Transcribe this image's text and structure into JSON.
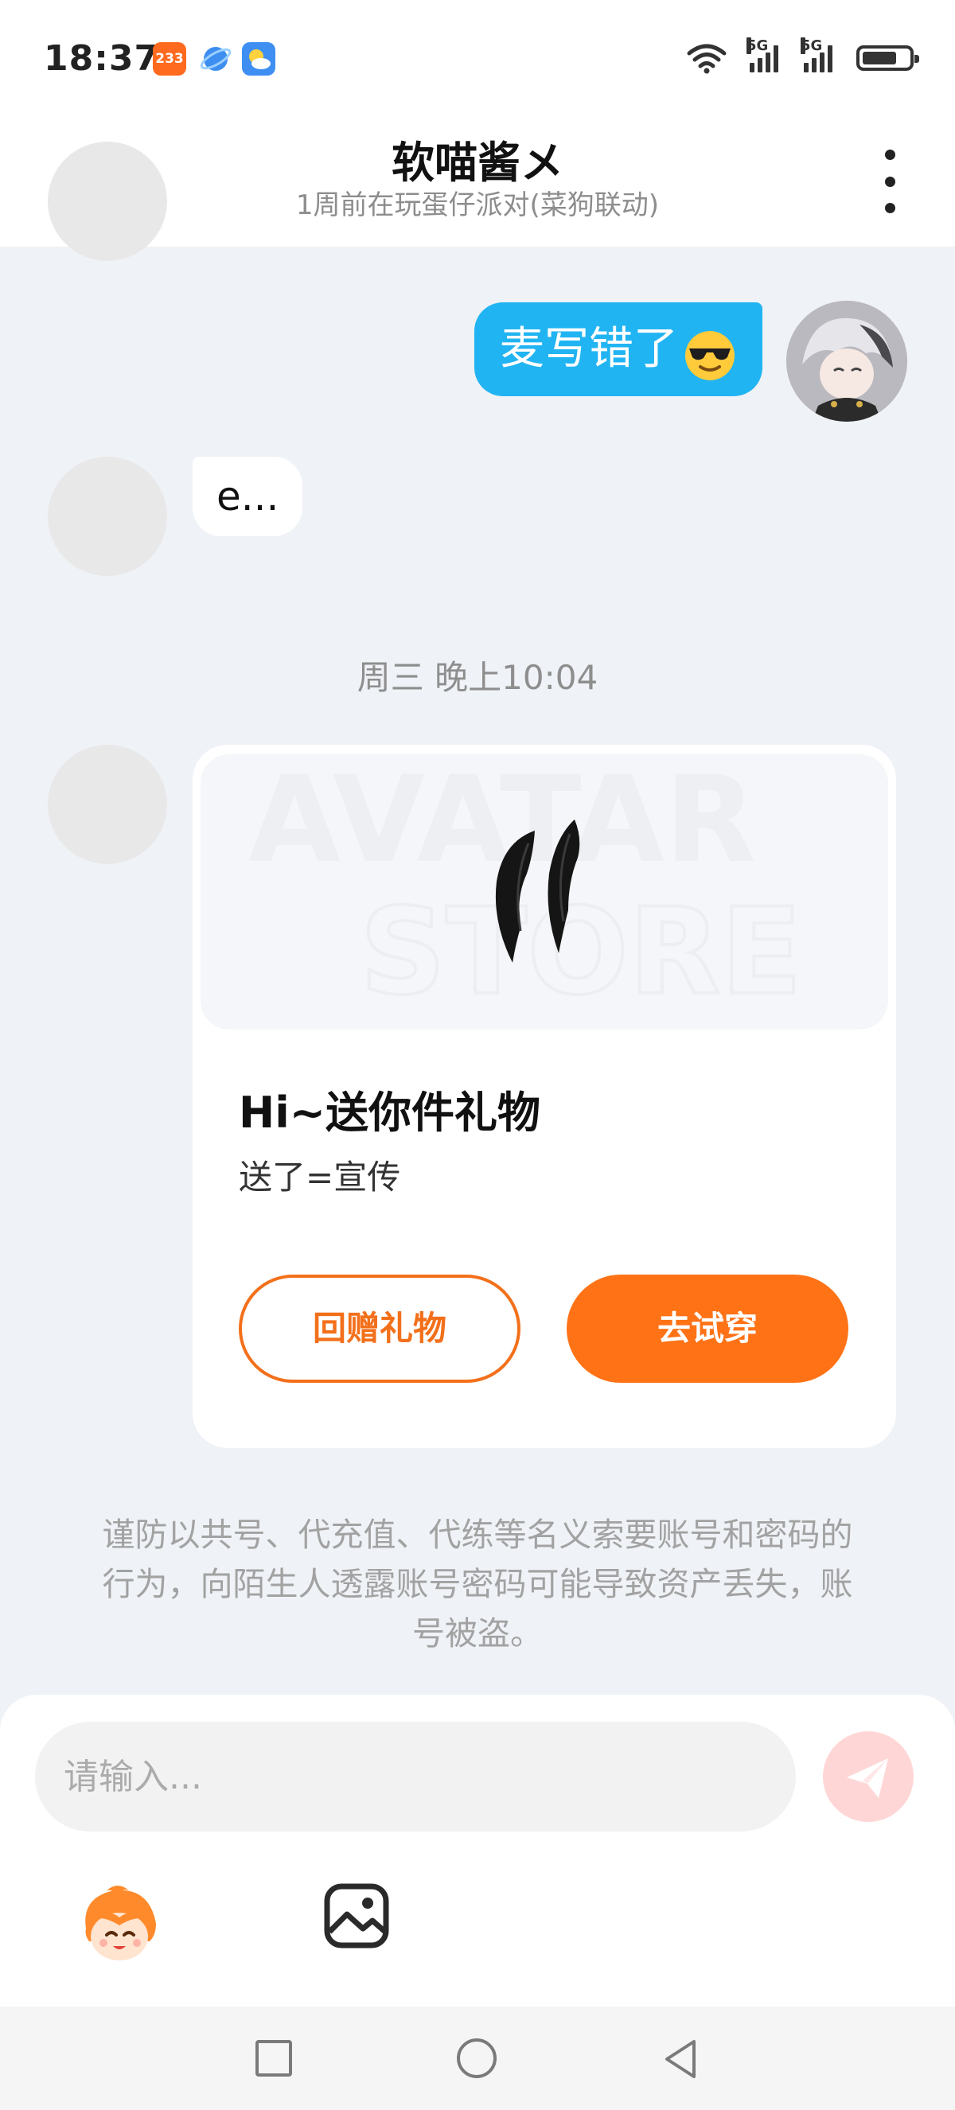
{
  "status_bar": {
    "time": "18:37",
    "app_badge": "233",
    "network_1": "5G",
    "network_2": "5G",
    "battery_level": 0.75
  },
  "header": {
    "title": "软喵酱メ",
    "subtitle": "1周前在玩蛋仔派对(菜狗联动)",
    "back_icon": "chevron-left-icon",
    "more_icon": "more-vertical-icon"
  },
  "messages": {
    "outgoing_text": "麦写错了",
    "outgoing_emoji": "sunglasses-face-emoji",
    "incoming_text": "e...",
    "timestamp": "周三 晚上10:04"
  },
  "gift_card": {
    "watermark_line1": "AVATAR",
    "watermark_line2": "STORE",
    "title": "Hi~送你件礼物",
    "message": "送了=宣传",
    "return_gift_label": "回赠礼物",
    "try_on_label": "去试穿"
  },
  "notice": "谨防以共号、代充值、代练等名义索要账号和密码的行为，向陌生人透露账号密码可能导致资产丢失，账号被盗。",
  "input": {
    "placeholder": "请输入...",
    "value": ""
  },
  "toolbar": {
    "emoji_icon": "character-emoji-icon",
    "image_icon": "image-icon",
    "send_icon": "send-icon"
  },
  "colors": {
    "accent_orange": "#ff7216",
    "bubble_blue": "#21b4f2",
    "page_bg": "#eff2f6"
  }
}
